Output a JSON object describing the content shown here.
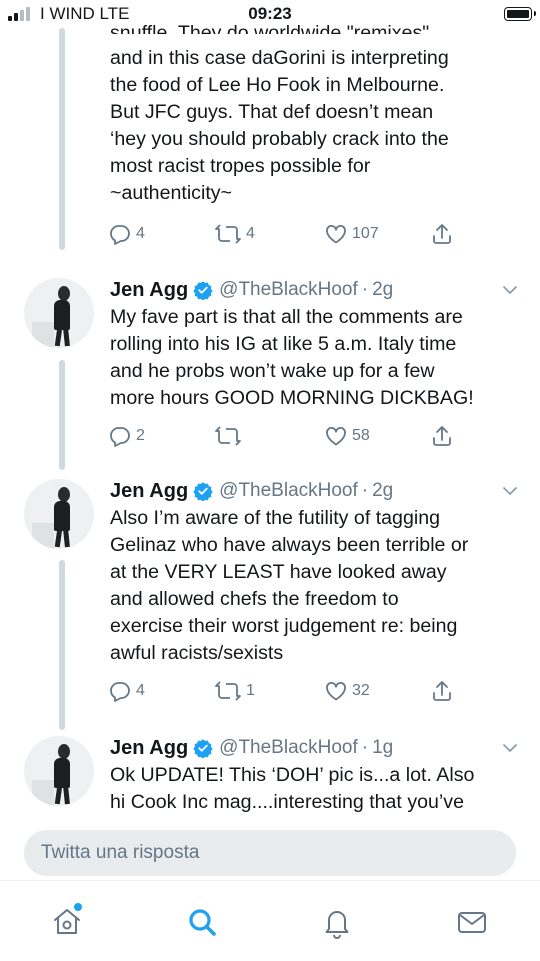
{
  "status_bar": {
    "carrier": "I WIND LTE",
    "time": "09:23",
    "signal_bars_active": 2,
    "signal_bars_total": 4
  },
  "colors": {
    "accent": "#1da1f2",
    "text": "#14171a",
    "secondary": "#657786",
    "thread_line": "#cfd9de"
  },
  "tweets": [
    {
      "text_cut_top": "snuffle. They do worldwide \"remixes\"",
      "text": "and in this case daGorini is interpreting\nthe food of Lee Ho Fook in Melbourne.\nBut JFC guys. That def doesn’t mean\n‘hey you should probably crack into the\nmost racist tropes possible for\n~authenticity~",
      "replies": "4",
      "retweets": "4",
      "likes": "107"
    },
    {
      "name": "Jen Agg",
      "handle": "@TheBlackHoof",
      "dot": "·",
      "time": "2g",
      "text": "My fave part is that all the comments are\nrolling into his IG at like 5 a.m. Italy time\nand he probs won’t wake up for a few\nmore hours GOOD MORNING DICKBAG!",
      "replies": "2",
      "retweets": "",
      "likes": "58"
    },
    {
      "name": "Jen Agg",
      "handle": "@TheBlackHoof",
      "dot": "·",
      "time": "2g",
      "text": "Also I’m aware of the futility of tagging\nGelinaz who have always been terrible or\nat the VERY LEAST have looked away\nand allowed chefs the freedom to\nexercise their worst judgement re: being\nawful racists/sexists",
      "replies": "4",
      "retweets": "1",
      "likes": "32"
    },
    {
      "name": "Jen Agg",
      "handle": "@TheBlackHoof",
      "dot": "·",
      "time": "1g",
      "text": "Ok UPDATE! This ‘DOH’ pic is...a lot. Also\nhi Cook Inc mag....interesting that you’ve"
    }
  ],
  "reply": {
    "placeholder": "Twitta una risposta"
  },
  "tab_bar": {
    "icons": [
      "home-icon",
      "search-icon",
      "notifications-icon",
      "messages-icon"
    ],
    "active": "search-icon",
    "home_has_new": true
  }
}
